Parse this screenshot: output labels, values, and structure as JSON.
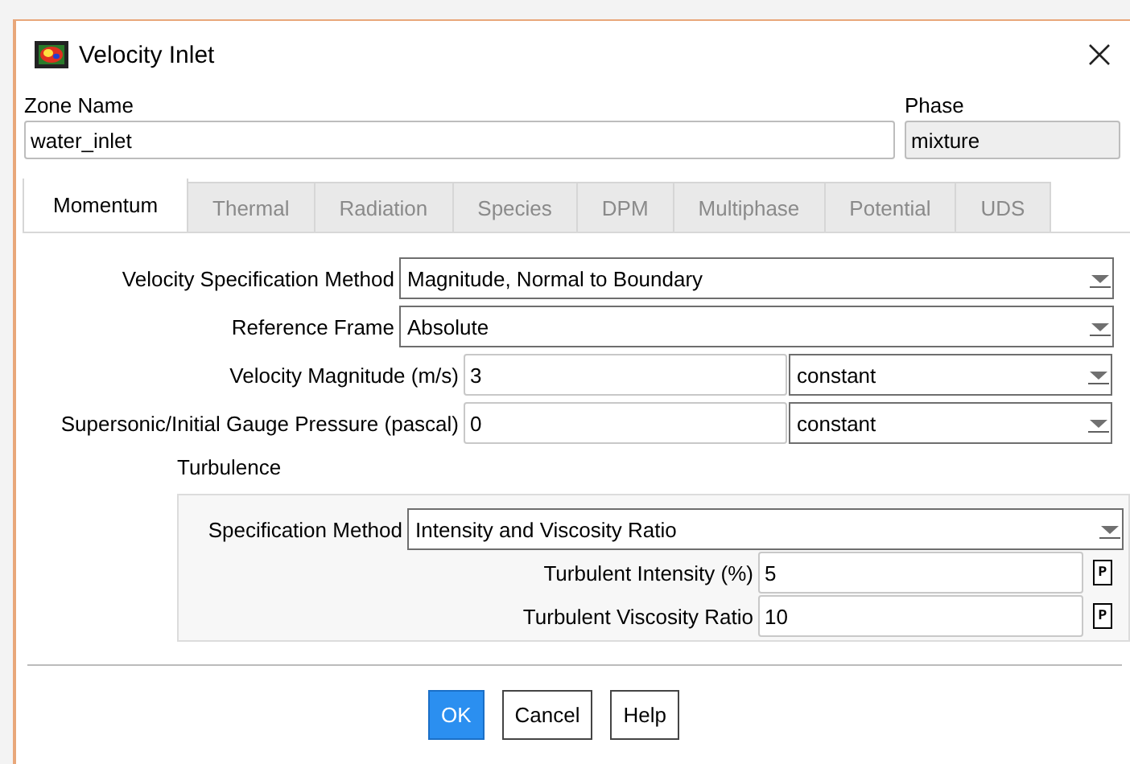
{
  "window": {
    "title": "Velocity Inlet"
  },
  "zone_name": {
    "label": "Zone Name",
    "value": "water_inlet"
  },
  "phase": {
    "label": "Phase",
    "value": "mixture",
    "disabled": true
  },
  "tabs": [
    {
      "label": "Momentum",
      "selected": true
    },
    {
      "label": "Thermal",
      "selected": false
    },
    {
      "label": "Radiation",
      "selected": false
    },
    {
      "label": "Species",
      "selected": false
    },
    {
      "label": "DPM",
      "selected": false
    },
    {
      "label": "Multiphase",
      "selected": false
    },
    {
      "label": "Potential",
      "selected": false
    },
    {
      "label": "UDS",
      "selected": false
    }
  ],
  "fields": [
    {
      "kind": "select",
      "label": "Velocity Specification Method",
      "value": "Magnitude, Normal to Boundary"
    },
    {
      "kind": "select",
      "label": "Reference Frame",
      "value": "Absolute"
    },
    {
      "kind": "input_select",
      "label": "Velocity Magnitude (m/s)",
      "value": "3",
      "option": "constant"
    },
    {
      "kind": "input_select",
      "label": "Supersonic/Initial Gauge Pressure (pascal)",
      "value": "0",
      "option": "constant"
    }
  ],
  "turbulence": {
    "label": "Turbulence",
    "fields": [
      {
        "kind": "select",
        "label": "Specification Method",
        "value": "Intensity and Viscosity Ratio"
      },
      {
        "kind": "input_param",
        "label": "Turbulent Intensity (%)",
        "value": "5",
        "param": "P"
      },
      {
        "kind": "input_param",
        "label": "Turbulent Viscosity Ratio",
        "value": "10",
        "param": "P"
      }
    ]
  },
  "buttons": [
    {
      "label": "OK",
      "default": true
    },
    {
      "label": "Cancel",
      "default": false
    },
    {
      "label": "Help",
      "default": false
    }
  ]
}
